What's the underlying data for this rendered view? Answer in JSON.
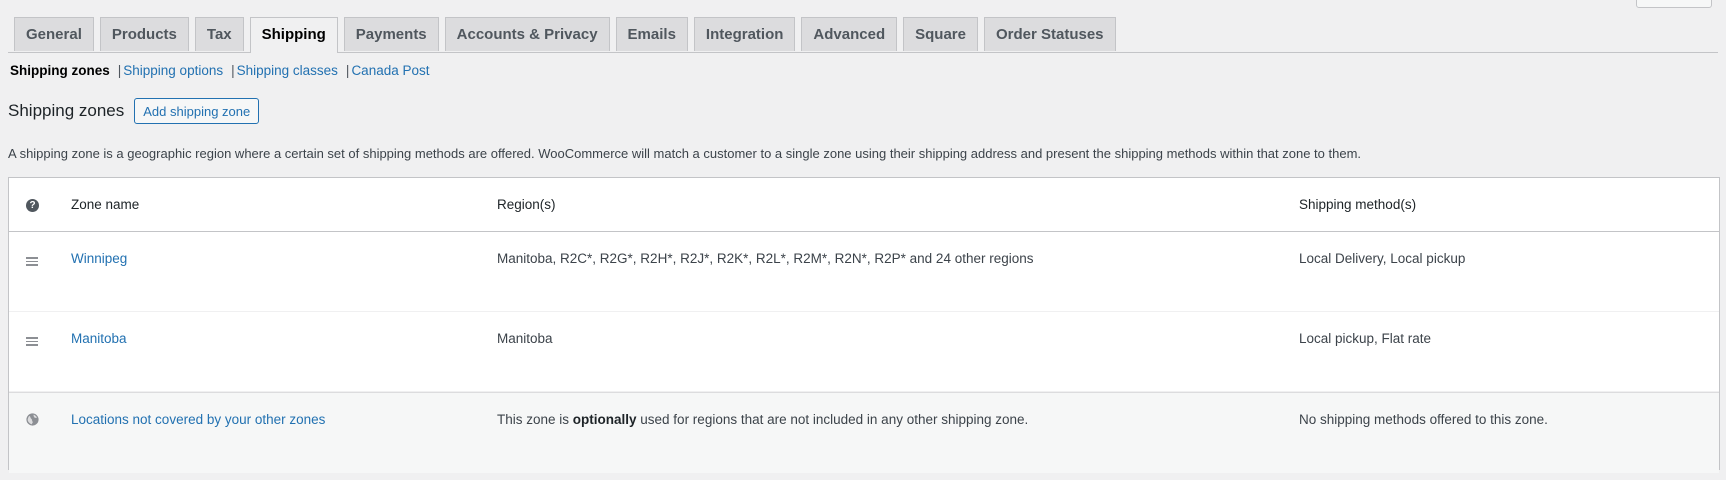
{
  "tabs": [
    {
      "label": "General",
      "active": false
    },
    {
      "label": "Products",
      "active": false
    },
    {
      "label": "Tax",
      "active": false
    },
    {
      "label": "Shipping",
      "active": true
    },
    {
      "label": "Payments",
      "active": false
    },
    {
      "label": "Accounts & Privacy",
      "active": false
    },
    {
      "label": "Emails",
      "active": false
    },
    {
      "label": "Integration",
      "active": false
    },
    {
      "label": "Advanced",
      "active": false
    },
    {
      "label": "Square",
      "active": false
    },
    {
      "label": "Order Statuses",
      "active": false
    }
  ],
  "subnav": {
    "current": "Shipping zones",
    "links": [
      "Shipping options",
      "Shipping classes",
      "Canada Post"
    ],
    "separator": "|"
  },
  "page": {
    "title": "Shipping zones",
    "add_button": "Add shipping zone",
    "description": "A shipping zone is a geographic region where a certain set of shipping methods are offered. WooCommerce will match a customer to a single zone using their shipping address and present the shipping methods within that zone to them."
  },
  "table": {
    "headers": {
      "name": "Zone name",
      "region": "Region(s)",
      "method": "Shipping method(s)"
    },
    "rows": [
      {
        "name": "Winnipeg",
        "region": "Manitoba, R2C*, R2G*, R2H*, R2J*, R2K*, R2L*, R2M*, R2N*, R2P* and 24 other regions",
        "method": "Local Delivery, Local pickup"
      },
      {
        "name": "Manitoba",
        "region": "Manitoba",
        "method": "Local pickup, Flat rate"
      }
    ],
    "fallback": {
      "name": "Locations not covered by your other zones",
      "region_before": "This zone is ",
      "region_bold": "optionally",
      "region_after": " used for regions that are not included in any other shipping zone.",
      "method": "No shipping methods offered to this zone."
    }
  },
  "icons": {
    "help": "help-icon",
    "drag": "drag-handle-icon",
    "globe": "globe-icon"
  },
  "colors": {
    "link": "#2271b1",
    "background": "#f0f0f1"
  }
}
